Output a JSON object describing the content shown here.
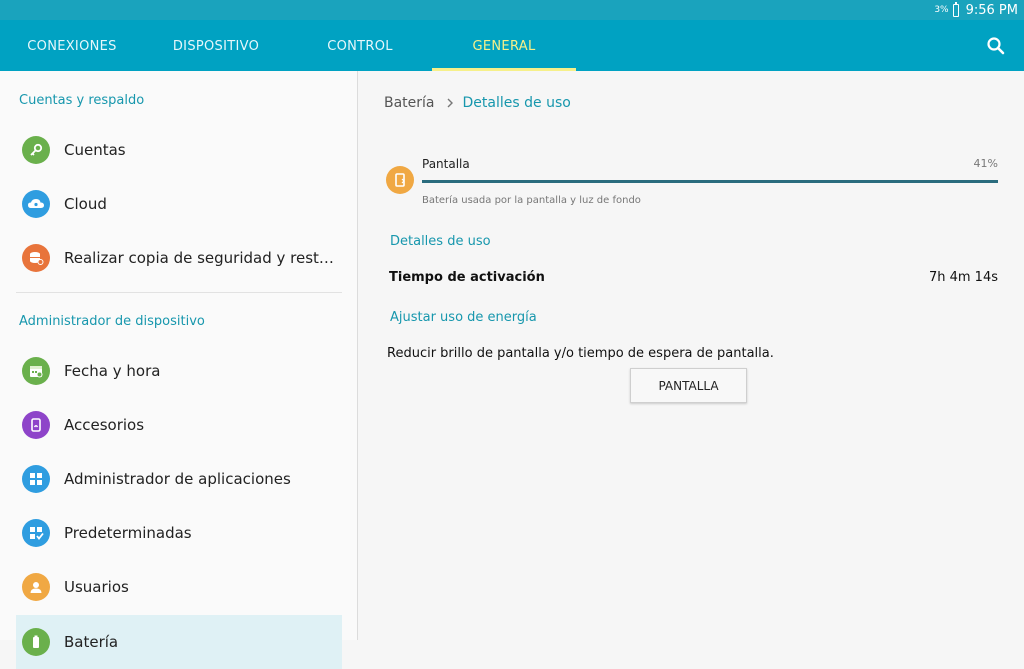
{
  "status_bar": {
    "battery_percent": "3%",
    "time": "9:56 PM"
  },
  "tabs": [
    {
      "label": "CONEXIONES",
      "active": false
    },
    {
      "label": "DISPOSITIVO",
      "active": false
    },
    {
      "label": "CONTROL",
      "active": false
    },
    {
      "label": "GENERAL",
      "active": true
    }
  ],
  "search_icon": "search-icon",
  "sidebar": {
    "section1_title": "Cuentas y respaldo",
    "section2_title": "Administrador de dispositivo",
    "items": [
      {
        "label": "Cuentas",
        "icon": "key-icon",
        "color": "#6ab04c"
      },
      {
        "label": "Cloud",
        "icon": "cloud-icon",
        "color": "#2f9de0"
      },
      {
        "label": "Realizar copia de seguridad y restab…",
        "icon": "backup-icon",
        "color": "#e8743b"
      },
      {
        "label": "Fecha y hora",
        "icon": "calendar-icon",
        "color": "#6ab04c"
      },
      {
        "label": "Accesorios",
        "icon": "accessory-icon",
        "color": "#8e44c9"
      },
      {
        "label": "Administrador de aplicaciones",
        "icon": "apps-grid-icon",
        "color": "#2f9de0"
      },
      {
        "label": "Predeterminadas",
        "icon": "defaults-icon",
        "color": "#2f9de0"
      },
      {
        "label": "Usuarios",
        "icon": "users-icon",
        "color": "#f0a843"
      },
      {
        "label": "Batería",
        "icon": "battery-icon",
        "color": "#6ab04c",
        "selected": true
      }
    ]
  },
  "main": {
    "breadcrumb": {
      "parent": "Batería",
      "current": "Detalles de uso"
    },
    "usage": {
      "name": "Pantalla",
      "percent_label": "41%",
      "fill_fraction": 1.0,
      "description": "Batería usada por la pantalla y luz de fondo",
      "icon": "screen-icon",
      "color": "#f0a843"
    },
    "details_header": "Detalles de uso",
    "uptime_label": "Tiempo de activación",
    "uptime_value": "7h 4m 14s",
    "adjust_header": "Ajustar uso de energía",
    "tip_text": "Reducir brillo de pantalla y/o tiempo de espera de pantalla.",
    "button_label": "PANTALLA"
  },
  "colors": {
    "primary": "#00a2c2",
    "active_tab": "#f6f08a",
    "accent_text": "#1797ad"
  }
}
